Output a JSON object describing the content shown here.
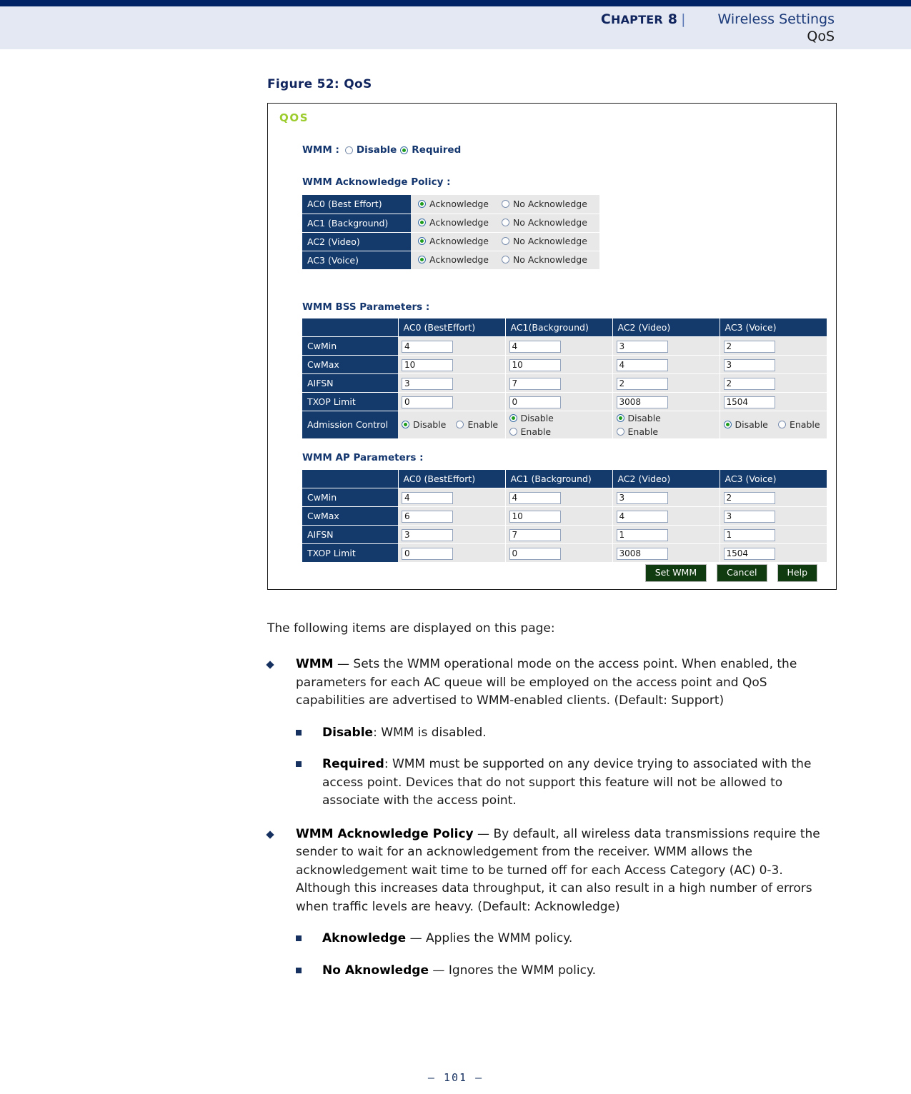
{
  "header": {
    "chapter_prefix": "C",
    "chapter_rest": "HAPTER",
    "chapter_number": "8",
    "separator": "|",
    "section": "Wireless Settings",
    "subsection": "QoS"
  },
  "figure": {
    "caption": "Figure 52:  QoS",
    "panel_title": "QOS"
  },
  "wmm": {
    "label": "WMM :",
    "options": [
      "Disable",
      "Required"
    ],
    "selected": "Required"
  },
  "ack_policy": {
    "heading": "WMM Acknowledge Policy :",
    "options": [
      "Acknowledge",
      "No Acknowledge"
    ],
    "rows": [
      {
        "label": "AC0 (Best Effort)",
        "selected": "Acknowledge"
      },
      {
        "label": "AC1 (Background)",
        "selected": "Acknowledge"
      },
      {
        "label": "AC2 (Video)",
        "selected": "Acknowledge"
      },
      {
        "label": "AC3 (Voice)",
        "selected": "Acknowledge"
      }
    ]
  },
  "bss_params": {
    "heading": "WMM BSS Parameters :",
    "corner": "",
    "columns": [
      "AC0 (BestEffort)",
      "AC1(Background)",
      "AC2 (Video)",
      "AC3 (Voice)"
    ],
    "rows": [
      {
        "label": "CwMin",
        "values": [
          "4",
          "4",
          "3",
          "2"
        ]
      },
      {
        "label": "CwMax",
        "values": [
          "10",
          "10",
          "4",
          "3"
        ]
      },
      {
        "label": "AIFSN",
        "values": [
          "3",
          "7",
          "2",
          "2"
        ]
      },
      {
        "label": "TXOP Limit",
        "values": [
          "0",
          "0",
          "3008",
          "1504"
        ]
      }
    ],
    "admission": {
      "label": "Admission Control",
      "options": [
        "Disable",
        "Enable"
      ],
      "selected": [
        "Disable",
        "Disable",
        "Disable",
        "Disable"
      ]
    }
  },
  "ap_params": {
    "heading": "WMM AP Parameters :",
    "corner": "",
    "columns": [
      "AC0 (BestEffort)",
      "AC1 (Background)",
      "AC2 (Video)",
      "AC3 (Voice)"
    ],
    "rows": [
      {
        "label": "CwMin",
        "values": [
          "4",
          "4",
          "3",
          "2"
        ]
      },
      {
        "label": "CwMax",
        "values": [
          "6",
          "10",
          "4",
          "3"
        ]
      },
      {
        "label": "AIFSN",
        "values": [
          "3",
          "7",
          "1",
          "1"
        ]
      },
      {
        "label": "TXOP Limit",
        "values": [
          "0",
          "0",
          "3008",
          "1504"
        ]
      }
    ]
  },
  "buttons": {
    "set": "Set WMM",
    "cancel": "Cancel",
    "help": "Help"
  },
  "body": {
    "intro": "The following items are displayed on this page:",
    "items": [
      {
        "term": "WMM",
        "dash": " — ",
        "text": "Sets the WMM operational mode on the access point. When enabled, the parameters for each AC queue will be employed on the access point and QoS capabilities are advertised to WMM-enabled clients. (Default: Support)",
        "subitems": [
          {
            "term": "Disable",
            "dash": ": ",
            "text": "WMM is disabled."
          },
          {
            "term": "Required",
            "dash": ": ",
            "text": "WMM must be supported on any device trying to associated with the access point. Devices that do not support this feature will not be allowed to associate with the access point."
          }
        ]
      },
      {
        "term": "WMM Acknowledge Policy",
        "dash": " — ",
        "text": "By default, all wireless data transmissions require the sender to wait for an acknowledgement from the receiver. WMM allows the acknowledgement wait time to be turned off for each Access Category (AC) 0-3. Although this increases data throughput, it can also result in a high number of errors when traffic levels are heavy. (Default: Acknowledge)",
        "subitems": [
          {
            "term": "Aknowledge",
            "dash": " — ",
            "text": "Applies the WMM policy."
          },
          {
            "term": "No Aknowledge",
            "dash": " — ",
            "text": "Ignores the WMM policy."
          }
        ]
      }
    ]
  },
  "footer": {
    "page": "–  101  –"
  },
  "colors": {
    "navy_bar": "#002366",
    "header_band": "#e4e8f2",
    "table_header": "#143a6b",
    "cell_bg": "#e8e8e8",
    "button_bg": "#103a10",
    "qos_green": "#9ccc2e",
    "radio_dot": "#1d9c1d"
  }
}
